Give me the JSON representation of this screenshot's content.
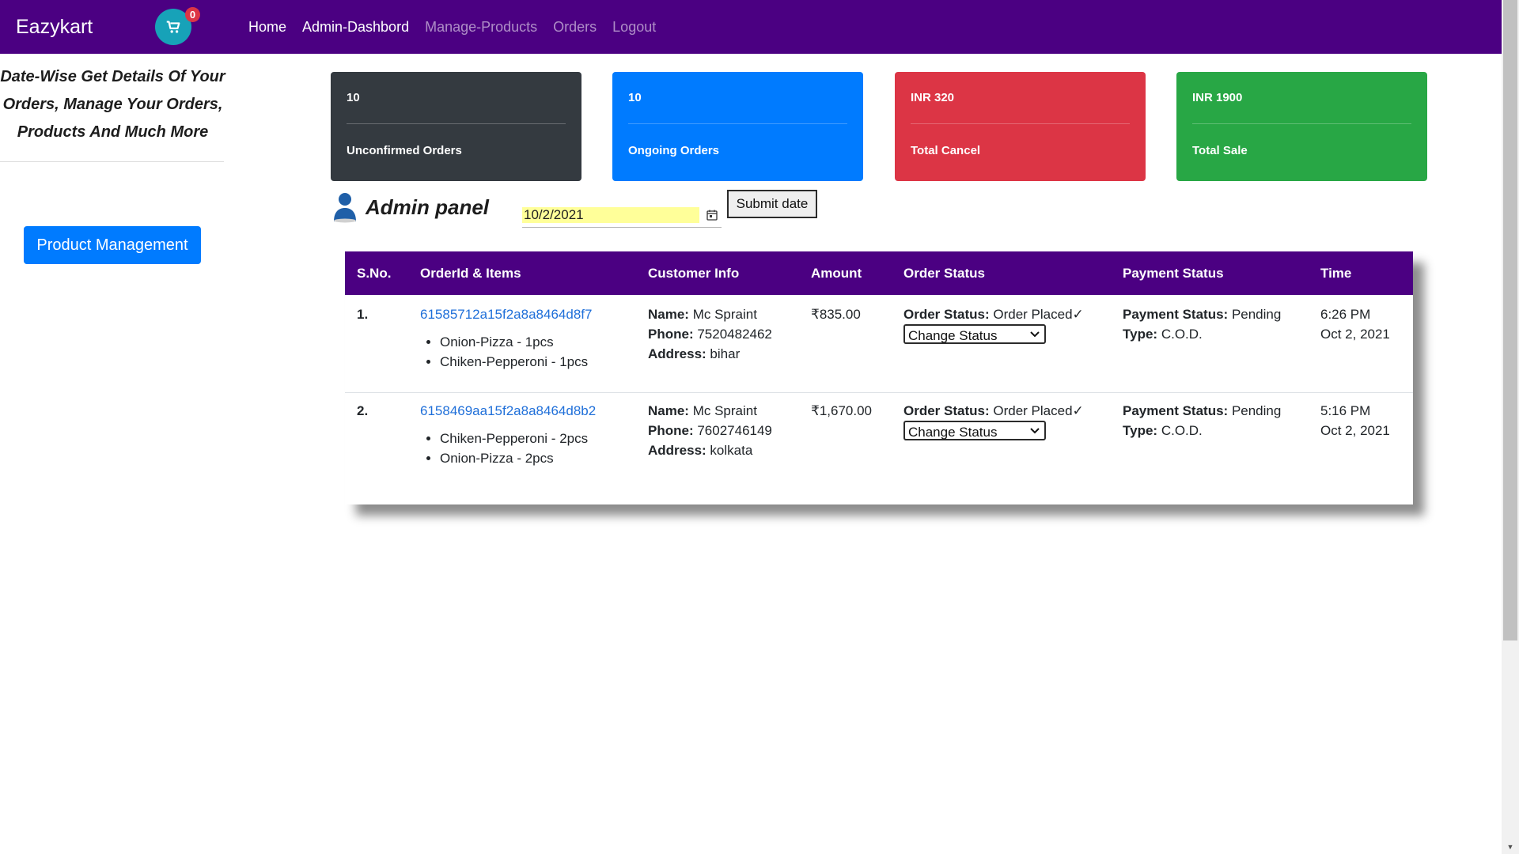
{
  "navbar": {
    "brand": "Eazykart",
    "cart_count": "0",
    "links": [
      {
        "label": "Home",
        "active": true
      },
      {
        "label": "Admin-Dashbord",
        "active": true
      },
      {
        "label": "Manage-Products",
        "active": false
      },
      {
        "label": "Orders",
        "active": false
      },
      {
        "label": "Logout",
        "active": false
      }
    ]
  },
  "sidebar": {
    "description": "Date-Wise Get Details Of Your Orders, Manage Your Orders, Products And Much More",
    "product_management_label": "Product Management"
  },
  "stats": [
    {
      "value": "10",
      "label": "Unconfirmed Orders",
      "color": "#343a40"
    },
    {
      "value": "10",
      "label": "Ongoing Orders",
      "color": "#007bff"
    },
    {
      "value": "INR 320",
      "label": "Total Cancel",
      "color": "#dc3545"
    },
    {
      "value": "INR 1900",
      "label": "Total Sale",
      "color": "#28a745"
    }
  ],
  "admin": {
    "title": "Admin panel",
    "date_value": "10/2/2021",
    "submit_label": "Submit date"
  },
  "table": {
    "headers": [
      "S.No.",
      "OrderId & Items",
      "Customer Info",
      "Amount",
      "Order Status",
      "Payment Status",
      "Time"
    ],
    "rows": [
      {
        "sno": "1.",
        "order_id": "61585712a15f2a8a8464d8f7",
        "items": [
          "Onion-Pizza - 1pcs",
          "Chiken-Pepperoni - 1pcs"
        ],
        "name_label": "Name:",
        "name": "Mc Spraint",
        "phone_label": "Phone:",
        "phone": "7520482462",
        "address_label": "Address:",
        "address": "bihar",
        "amount": "₹835.00",
        "order_status_label": "Order Status:",
        "order_status": "Order Placed✓",
        "change_status_label": "Change Status",
        "payment_status_label": "Payment Status:",
        "payment_status": "Pending",
        "type_label": "Type:",
        "type": "C.O.D.",
        "time": "6:26 PM",
        "date": "Oct 2, 2021"
      },
      {
        "sno": "2.",
        "order_id": "6158469aa15f2a8a8464d8b2",
        "items": [
          "Chiken-Pepperoni - 2pcs",
          "Onion-Pizza - 2pcs"
        ],
        "name_label": "Name:",
        "name": "Mc Spraint",
        "phone_label": "Phone:",
        "phone": "7602746149",
        "address_label": "Address:",
        "address": "kolkata",
        "amount": "₹1,670.00",
        "order_status_label": "Order Status:",
        "order_status": "Order Placed✓",
        "change_status_label": "Change Status",
        "payment_status_label": "Payment Status:",
        "payment_status": "Pending",
        "type_label": "Type:",
        "type": "C.O.D.",
        "time": "5:16 PM",
        "date": "Oct 2, 2021"
      }
    ]
  },
  "icons": {
    "cart": "shopping-cart-icon",
    "user": "user-icon",
    "calendar": "calendar-icon",
    "caret": "chevron-down-icon"
  },
  "colors": {
    "navbar": "#4b0082",
    "table_header": "#4b0082",
    "link": "#1f6fd9",
    "primary_button": "#007bff"
  }
}
